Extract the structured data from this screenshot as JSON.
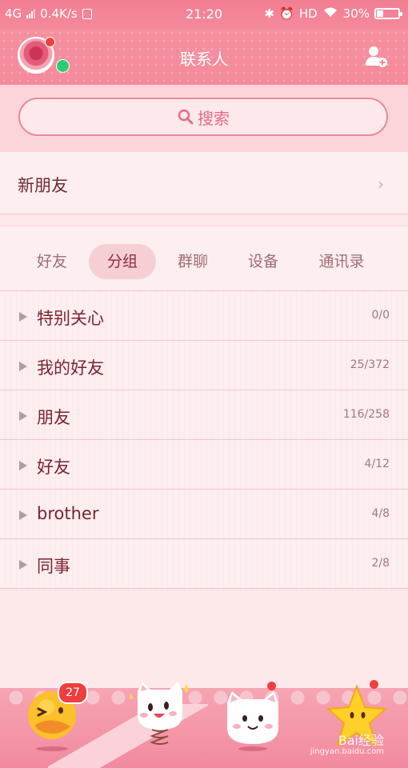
{
  "status_bar": {
    "network": "4G",
    "speed": "0.4K/s",
    "time": "21:20",
    "hd": "HD",
    "battery_text": "30%",
    "battery_level": 0.3
  },
  "header": {
    "title": "联系人"
  },
  "search": {
    "placeholder": "搜索"
  },
  "new_friends": {
    "label": "新朋友"
  },
  "tabs": [
    {
      "label": "好友",
      "active": false
    },
    {
      "label": "分组",
      "active": true
    },
    {
      "label": "群聊",
      "active": false
    },
    {
      "label": "设备",
      "active": false
    },
    {
      "label": "通讯录",
      "active": false
    }
  ],
  "groups": [
    {
      "name": "特别关心",
      "count": "0/0"
    },
    {
      "name": "我的好友",
      "count": "25/372"
    },
    {
      "name": "朋友",
      "count": "116/258"
    },
    {
      "name": "好友",
      "count": "4/12"
    },
    {
      "name": "brother",
      "count": "4/8"
    },
    {
      "name": "同事",
      "count": "2/8"
    }
  ],
  "bottom_nav": {
    "message_badge": "27"
  },
  "watermark": {
    "brand": "Bai经验",
    "url": "jingyan.baidu.com"
  },
  "colors": {
    "header_pink": "#f48a9c",
    "accent_text": "#7a2430",
    "badge_red": "#ef3e3e"
  }
}
